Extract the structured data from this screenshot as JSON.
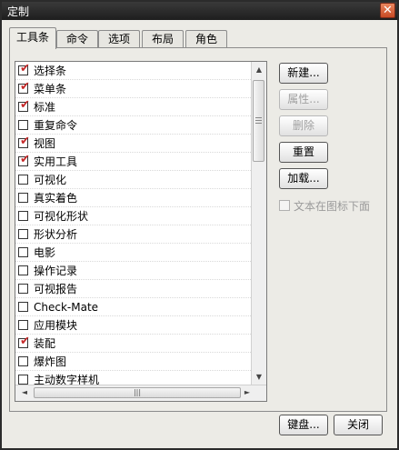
{
  "window": {
    "title": "定制",
    "close_glyph": "✕"
  },
  "tabs": [
    {
      "label": "工具条",
      "active": true
    },
    {
      "label": "命令",
      "active": false
    },
    {
      "label": "选项",
      "active": false
    },
    {
      "label": "布局",
      "active": false
    },
    {
      "label": "角色",
      "active": false
    }
  ],
  "toolbars": [
    {
      "label": "选择条",
      "checked": true
    },
    {
      "label": "菜单条",
      "checked": true
    },
    {
      "label": "标准",
      "checked": true
    },
    {
      "label": "重复命令",
      "checked": false
    },
    {
      "label": "视图",
      "checked": true
    },
    {
      "label": "实用工具",
      "checked": true
    },
    {
      "label": "可视化",
      "checked": false
    },
    {
      "label": "真实着色",
      "checked": false
    },
    {
      "label": "可视化形状",
      "checked": false
    },
    {
      "label": "形状分析",
      "checked": false
    },
    {
      "label": "电影",
      "checked": false
    },
    {
      "label": "操作记录",
      "checked": false
    },
    {
      "label": "可视报告",
      "checked": false
    },
    {
      "label": "Check-Mate",
      "checked": false
    },
    {
      "label": "应用模块",
      "checked": false
    },
    {
      "label": "装配",
      "checked": true
    },
    {
      "label": "爆炸图",
      "checked": false
    },
    {
      "label": "主动数字样机",
      "checked": false
    }
  ],
  "check_glyph": "✔",
  "scroll": {
    "up": "▲",
    "down": "▼",
    "left": "◄",
    "right": "►",
    "h_grip": "|||"
  },
  "side_buttons": {
    "new": "新建...",
    "properties": "属性...",
    "delete": "删除",
    "reset": "重置",
    "load": "加载..."
  },
  "text_below_icon": {
    "label": "文本在图标下面",
    "checked": false,
    "enabled": false
  },
  "footer": {
    "keyboard": "键盘...",
    "close": "关闭"
  }
}
